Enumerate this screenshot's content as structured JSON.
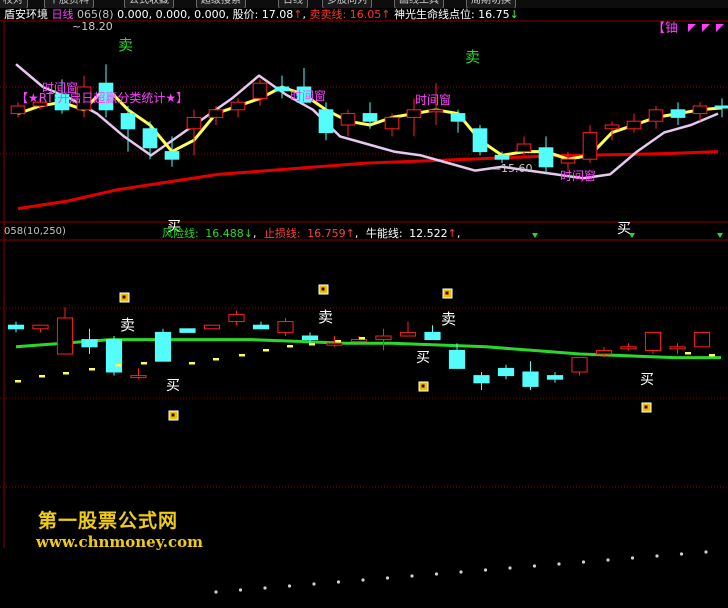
{
  "toolbar": {
    "tabs": [
      "校对",
      "个股资料",
      "公式收藏",
      "超级搜索",
      "日线",
      "多股同列",
      "画线工具",
      "周期切换"
    ]
  },
  "header": {
    "stock_name": "盾安环境",
    "period": "日线",
    "param": "065(8)",
    "v1": "0.000",
    "v2": "0.000",
    "v3": "0.000",
    "price_label": "股价:",
    "price_value": "17.08",
    "sell_label": "卖卖线:",
    "sell_value": "16.05",
    "life_label": "神光生命线点位:",
    "life_value": "16.75",
    "arrow_up": "↑",
    "arrow_down": "↓"
  },
  "top_right_tag": "【铀",
  "upper_panel": {
    "stats_banner": "【★RT·开启日超赢分类统计★】",
    "high_label": "18.20",
    "low_label": "15.60",
    "buy_marker": "买",
    "sell_marker": "卖",
    "window_marker": "时间窗"
  },
  "lower_header": {
    "code": "058",
    "params": "(10,250)",
    "risk_label": "风险线:",
    "risk_value": "16.488",
    "stop_label": "止损线:",
    "stop_value": "16.759",
    "bull_label": "牛能线:",
    "bull_value": "12.522"
  },
  "watermark": {
    "title": "第一股票公式网",
    "url": "www.chnmoney.com"
  },
  "colors": {
    "up": "#ff2020",
    "down": "#54fcfc",
    "yellow_line": "#ffff55",
    "pink_line": "#e8c8f0",
    "red_ma": "#e00000",
    "green_line": "#2ad82a",
    "magenta": "#ff40ff",
    "grid": "#8b0000"
  },
  "chart_data": [
    {
      "type": "candlestick",
      "title": "盾安环境 日线",
      "series": [
        {
          "name": "K线",
          "ohlc": [
            [
              16.9,
              17.2,
              16.8,
              17.1
            ],
            [
              17.1,
              17.3,
              17.0,
              17.2
            ],
            [
              17.4,
              17.8,
              16.9,
              17.0
            ],
            [
              17.0,
              17.9,
              16.8,
              17.6
            ],
            [
              17.7,
              18.2,
              16.8,
              17.0
            ],
            [
              16.9,
              17.1,
              15.9,
              16.5
            ],
            [
              16.5,
              16.7,
              15.7,
              16.0
            ],
            [
              15.9,
              16.3,
              15.5,
              15.7
            ],
            [
              16.5,
              17.0,
              15.8,
              16.8
            ],
            [
              16.8,
              17.1,
              16.6,
              17.0
            ],
            [
              17.0,
              17.3,
              16.8,
              17.2
            ],
            [
              17.3,
              17.8,
              17.1,
              17.7
            ],
            [
              17.6,
              17.9,
              17.3,
              17.5
            ],
            [
              17.6,
              18.1,
              17.2,
              17.2
            ],
            [
              17.0,
              17.2,
              16.2,
              16.4
            ],
            [
              16.6,
              17.0,
              16.3,
              16.9
            ],
            [
              16.9,
              17.2,
              16.5,
              16.7
            ],
            [
              16.5,
              16.9,
              16.3,
              16.8
            ],
            [
              16.8,
              17.3,
              16.3,
              17.0
            ],
            [
              17.0,
              17.7,
              16.6,
              17.0
            ],
            [
              16.9,
              17.0,
              16.4,
              16.7
            ],
            [
              16.5,
              16.6,
              15.8,
              15.9
            ],
            [
              15.8,
              15.9,
              15.6,
              15.7
            ],
            [
              15.9,
              16.3,
              15.8,
              16.1
            ],
            [
              16.0,
              16.3,
              15.3,
              15.5
            ],
            [
              15.6,
              15.9,
              15.4,
              15.7
            ],
            [
              15.7,
              16.6,
              15.6,
              16.4
            ],
            [
              16.5,
              16.7,
              16.2,
              16.6
            ],
            [
              16.5,
              16.9,
              16.4,
              16.7
            ],
            [
              16.7,
              17.1,
              16.5,
              17.0
            ],
            [
              17.0,
              17.2,
              16.6,
              16.8
            ],
            [
              16.9,
              17.2,
              16.7,
              17.1
            ],
            [
              17.1,
              17.3,
              16.8,
              17.08
            ]
          ]
        },
        {
          "name": "黄线",
          "values": [
            16.9,
            17.1,
            17.2,
            17.0,
            17.6,
            17.0,
            16.6,
            15.9,
            16.2,
            16.9,
            17.1,
            17.3,
            17.6,
            17.4,
            17.0,
            16.7,
            16.6,
            16.8,
            16.9,
            17.0,
            16.9,
            16.2,
            15.8,
            15.9,
            15.9,
            15.7,
            15.8,
            16.4,
            16.6,
            16.8,
            16.9,
            17.0,
            17.05
          ]
        },
        {
          "name": "粉线",
          "values": [
            18.2,
            17.6,
            17.3,
            16.9,
            16.3,
            15.8,
            16.3,
            16.8,
            17.3,
            17.9,
            17.4,
            17.0,
            16.3,
            16.1,
            15.9,
            15.8,
            15.6,
            15.4,
            15.5,
            15.4,
            15.3,
            15.2,
            15.3,
            15.9,
            16.4,
            16.6,
            16.9
          ]
        },
        {
          "name": "红线",
          "values": [
            14.4,
            14.6,
            14.9,
            15.1,
            15.3,
            15.4,
            15.5,
            15.6,
            15.65,
            15.7,
            15.75,
            15.8,
            15.82,
            15.85,
            15.9
          ]
        }
      ]
    },
    {
      "type": "candlestick",
      "title": "058(10,250)",
      "series": [
        {
          "name": "K线",
          "ohlc": [
            [
              16.6,
              16.7,
              16.4,
              16.5
            ],
            [
              16.5,
              16.6,
              16.4,
              16.6
            ],
            [
              15.8,
              17.1,
              15.8,
              16.8
            ],
            [
              16.2,
              16.5,
              15.8,
              16.0
            ],
            [
              16.2,
              16.3,
              15.2,
              15.3
            ],
            [
              15.2,
              15.4,
              15.1,
              15.2
            ],
            [
              16.4,
              16.5,
              15.6,
              15.6
            ],
            [
              16.5,
              16.5,
              16.4,
              16.4
            ],
            [
              16.5,
              16.6,
              16.5,
              16.6
            ],
            [
              16.7,
              17.0,
              16.6,
              16.9
            ],
            [
              16.6,
              16.7,
              16.5,
              16.5
            ],
            [
              16.4,
              16.8,
              16.3,
              16.7
            ],
            [
              16.3,
              16.4,
              16.1,
              16.2
            ],
            [
              16.1,
              16.3,
              16.0,
              16.1
            ],
            [
              16.2,
              16.3,
              16.2,
              16.2
            ],
            [
              16.2,
              16.5,
              15.9,
              16.3
            ],
            [
              16.3,
              16.7,
              16.3,
              16.4
            ],
            [
              16.4,
              16.6,
              16.2,
              16.2
            ],
            [
              15.9,
              16.1,
              15.4,
              15.4
            ],
            [
              15.2,
              15.3,
              14.8,
              15.0
            ],
            [
              15.4,
              15.5,
              15.1,
              15.2
            ],
            [
              15.3,
              15.6,
              14.8,
              14.9
            ],
            [
              15.2,
              15.3,
              15.0,
              15.1
            ],
            [
              15.3,
              15.7,
              15.2,
              15.7
            ],
            [
              15.8,
              16.0,
              15.7,
              15.9
            ],
            [
              16.0,
              16.1,
              15.9,
              16.0
            ],
            [
              15.9,
              16.4,
              15.8,
              16.4
            ],
            [
              16.0,
              16.1,
              15.8,
              16.0
            ],
            [
              16.0,
              16.4,
              16.0,
              16.4
            ]
          ]
        },
        {
          "name": "绿线",
          "values": [
            16.0,
            16.1,
            16.2,
            16.2,
            16.2,
            16.2,
            16.15,
            16.1,
            16.1,
            16.05,
            16.0,
            15.9,
            15.8,
            15.75,
            15.7,
            15.7
          ]
        }
      ]
    }
  ]
}
